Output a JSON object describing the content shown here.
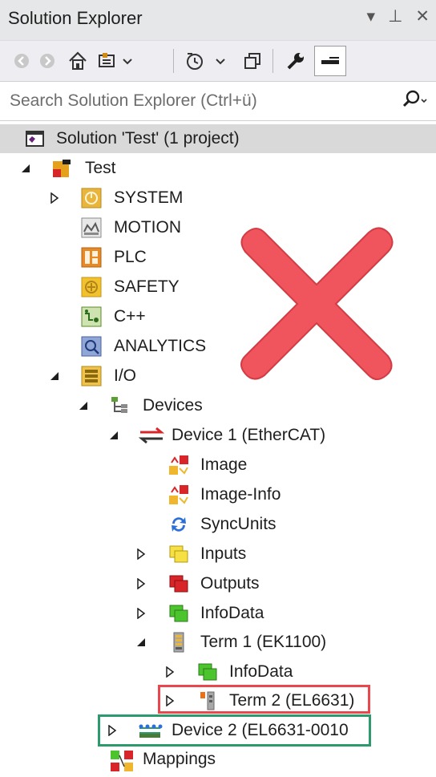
{
  "window": {
    "title": "Solution Explorer",
    "controls": [
      "▾",
      "⊥",
      "✕"
    ]
  },
  "toolbar": {
    "buttons": [
      "back-icon",
      "forward-icon",
      "home-icon",
      "sync-icon",
      "history-icon",
      "collapse-icon",
      "wrench-icon",
      "pin-icon"
    ]
  },
  "search": {
    "placeholder": "Search Solution Explorer (Ctrl+ü)"
  },
  "tree": {
    "solution": "Solution 'Test' (1 project)",
    "project": "Test",
    "system": "SYSTEM",
    "motion": "MOTION",
    "plc": "PLC",
    "safety": "SAFETY",
    "cpp": "C++",
    "analytics": "ANALYTICS",
    "io": "I/O",
    "devices": "Devices",
    "device1": "Device 1 (EtherCAT)",
    "image": "Image",
    "image_info": "Image-Info",
    "syncunits": "SyncUnits",
    "inputs": "Inputs",
    "outputs": "Outputs",
    "infodata": "InfoData",
    "term1": "Term 1 (EK1100)",
    "term1_infodata": "InfoData",
    "term2": "Term 2 (EL6631)",
    "device2": "Device 2 (EL6631-0010",
    "mappings": "Mappings"
  },
  "colors": {
    "highlight_red": "#e8484d",
    "highlight_green": "#2c9a6c",
    "cross": "#f0555d",
    "selection": "#d9d9d9"
  }
}
